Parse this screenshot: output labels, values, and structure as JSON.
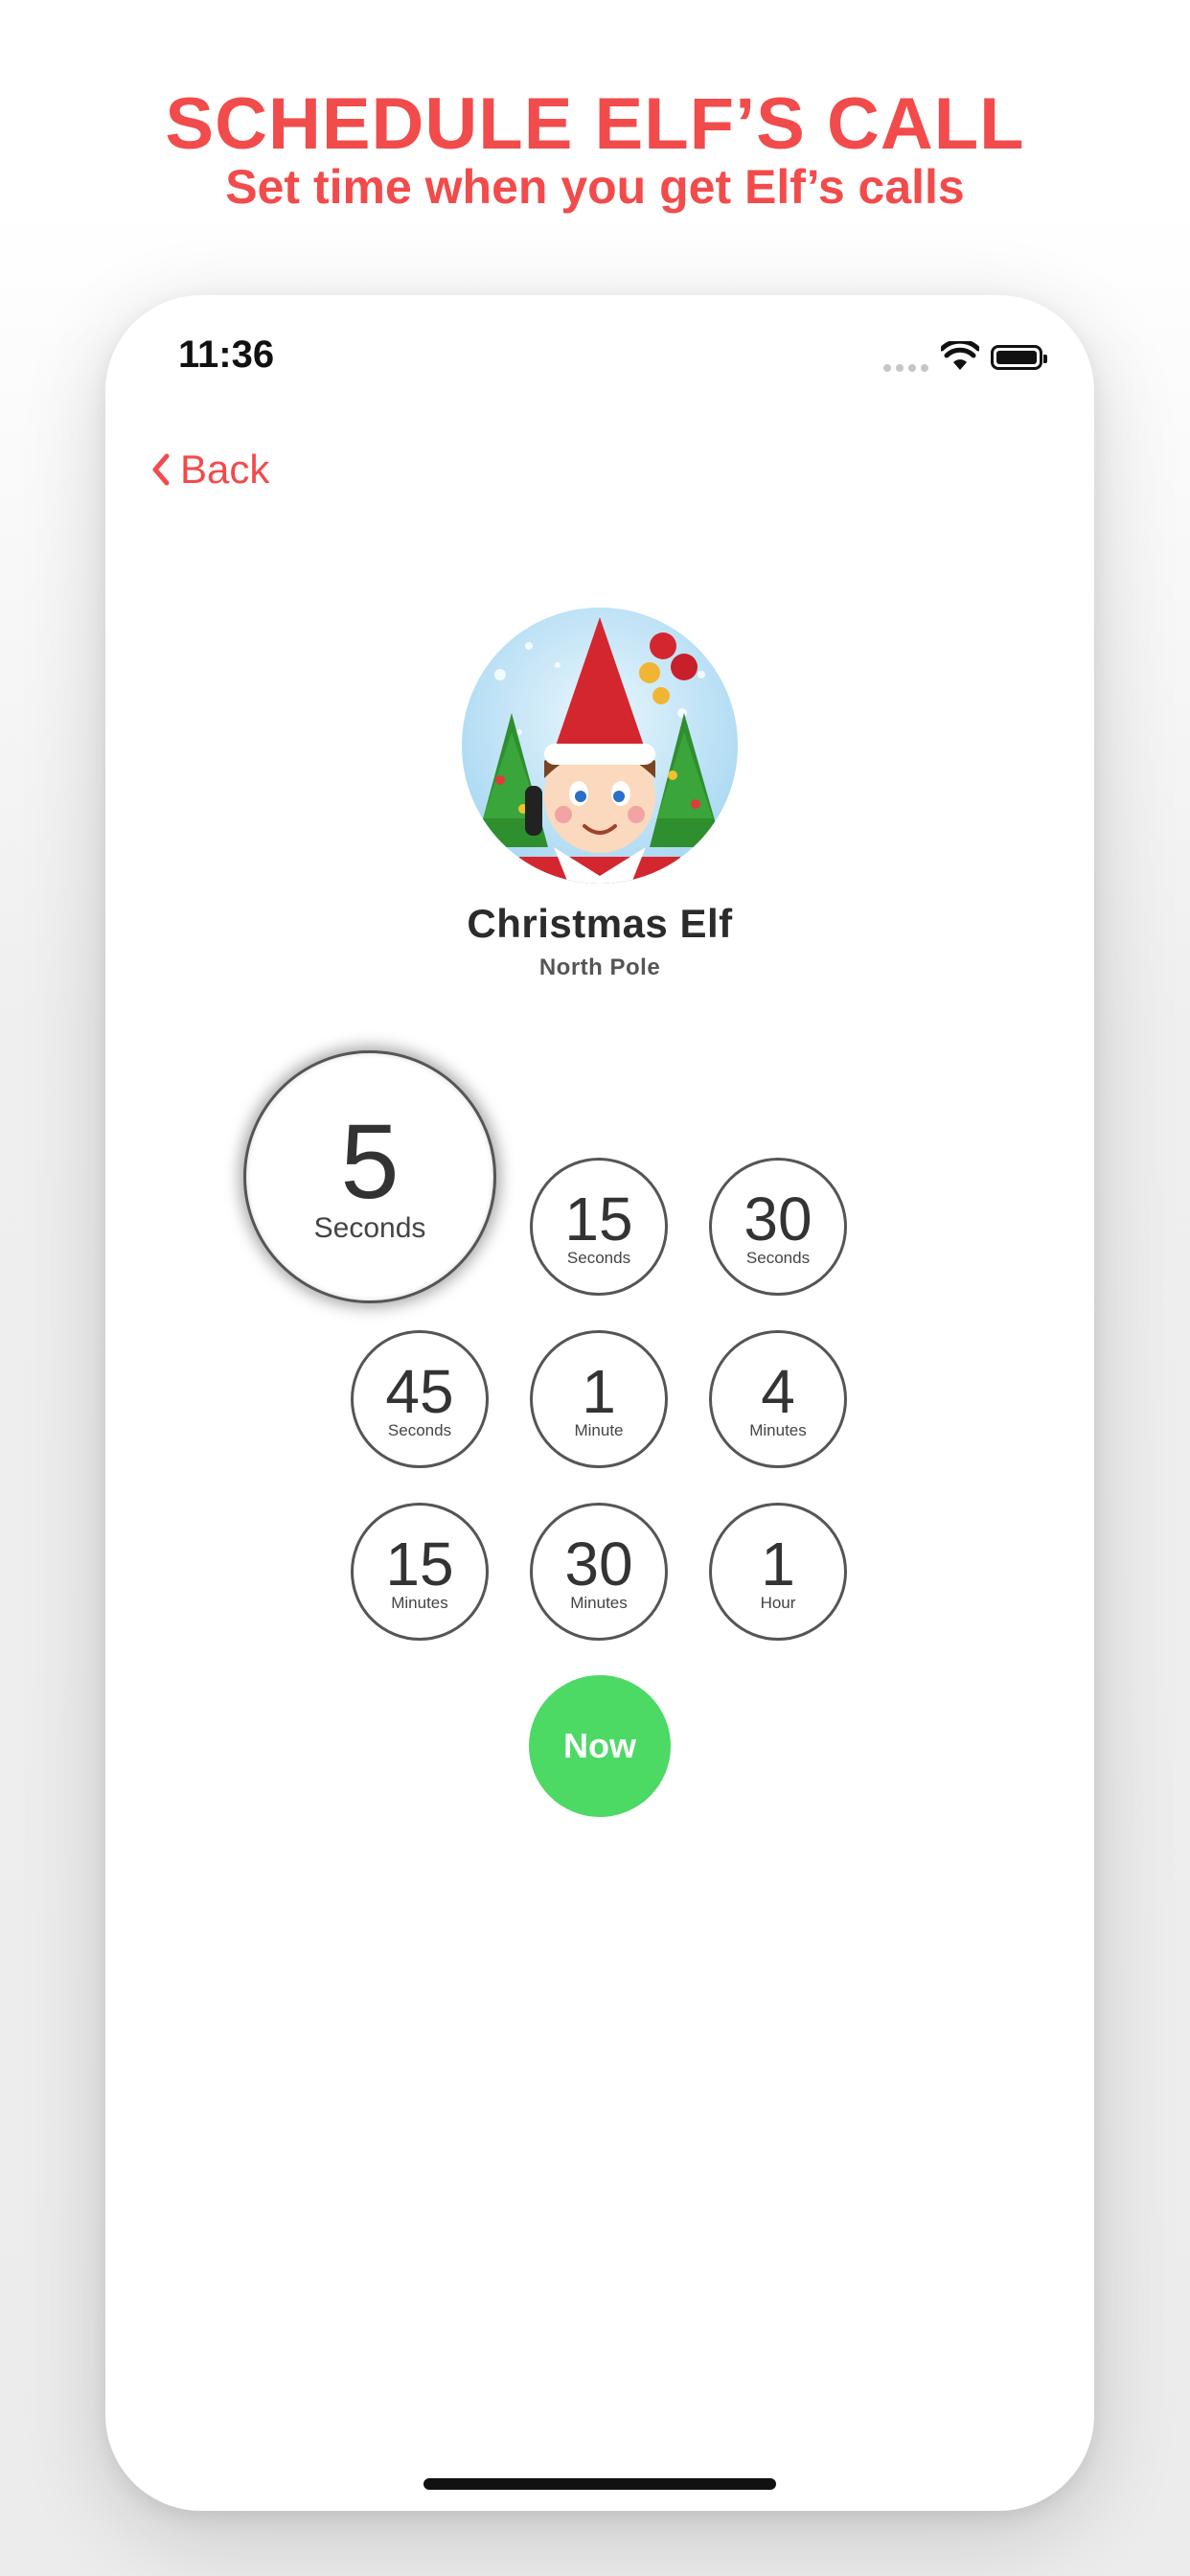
{
  "headline": {
    "title": "SCHEDULE ELF’S CALL",
    "subtitle": "Set time when you get Elf’s calls"
  },
  "status_bar": {
    "time": "11:36",
    "icons": [
      "cellular-signal-icon",
      "wifi-icon",
      "battery-icon"
    ],
    "battery_level": 1.0
  },
  "nav": {
    "back_label": "Back",
    "back_icon": "chevron-left-icon"
  },
  "contact": {
    "name": "Christmas Elf",
    "location": "North Pole",
    "avatar": "elf-avatar"
  },
  "timer_options": [
    {
      "value": "5",
      "unit": "Seconds",
      "highlighted": true
    },
    {
      "value": "15",
      "unit": "Seconds"
    },
    {
      "value": "30",
      "unit": "Seconds"
    },
    {
      "value": "45",
      "unit": "Seconds"
    },
    {
      "value": "1",
      "unit": "Minute"
    },
    {
      "value": "4",
      "unit": "Minutes"
    },
    {
      "value": "15",
      "unit": "Minutes"
    },
    {
      "value": "30",
      "unit": "Minutes"
    },
    {
      "value": "1",
      "unit": "Hour"
    }
  ],
  "now_button": {
    "label": "Now"
  },
  "colors": {
    "accent": "#f24b4b",
    "now_green": "#4cd964",
    "text_dark": "#2b2b2b"
  }
}
